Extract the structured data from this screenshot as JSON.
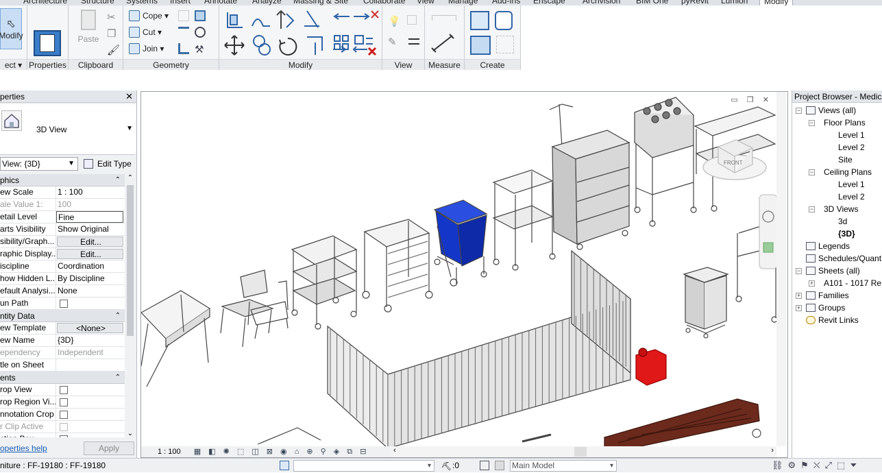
{
  "menu": {
    "tabs": [
      "Architecture",
      "Structure",
      "Systems",
      "Insert",
      "Annotate",
      "Analyze",
      "Massing & Site",
      "Collaborate",
      "View",
      "Manage",
      "Add-Ins",
      "Enscape",
      "Archvision",
      "BIM One",
      "pyRevit",
      "Lumion",
      "Modify"
    ],
    "active": "Modify"
  },
  "ribbon": {
    "select": {
      "modify_label": "Modify",
      "panel_label": "ect"
    },
    "properties": {
      "panel_label": "Properties"
    },
    "clipboard": {
      "paste_label": "Paste",
      "panel_label": "Clipboard"
    },
    "geometry": {
      "cope_label": "Cope",
      "cut_label": "Cut",
      "join_label": "Join",
      "panel_label": "Geometry"
    },
    "modify": {
      "panel_label": "Modify"
    },
    "view": {
      "panel_label": "View"
    },
    "measure": {
      "panel_label": "Measure"
    },
    "create": {
      "panel_label": "Create"
    }
  },
  "properties": {
    "title": "perties",
    "type_name": "3D View",
    "view_selector": "View: {3D}",
    "edit_type_label": "Edit Type",
    "sections": {
      "graphics": "phics",
      "identity": "ntity Data",
      "extents": "ents"
    },
    "rows": {
      "view_scale": {
        "key": "ew Scale",
        "value": "1 : 100"
      },
      "scale_value": {
        "key": "ale Value   1:",
        "value": "100"
      },
      "detail_level": {
        "key": "etail Level",
        "value": "Fine"
      },
      "parts_visibility": {
        "key": "arts Visibility",
        "value": "Show Original"
      },
      "vis_graph": {
        "key": "sibility/Graph...",
        "value": "Edit..."
      },
      "graphic_display": {
        "key": "raphic Display...",
        "value": "Edit..."
      },
      "discipline": {
        "key": "iscipline",
        "value": "Coordination"
      },
      "show_hidden": {
        "key": "how Hidden L...",
        "value": "By Discipline"
      },
      "default_analysis": {
        "key": "efault Analysi...",
        "value": "None"
      },
      "sun_path": {
        "key": "un Path"
      },
      "view_template": {
        "key": "ew Template",
        "value": "<None>"
      },
      "view_name": {
        "key": "ew Name",
        "value": "{3D}"
      },
      "dependency": {
        "key": "ependency",
        "value": "Independent"
      },
      "title_on_sheet": {
        "key": "tle on Sheet",
        "value": ""
      },
      "crop_view": {
        "key": "rop View"
      },
      "crop_region": {
        "key": "rop Region Vi..."
      },
      "annotation_crop": {
        "key": "nnotation Crop"
      },
      "far_clip": {
        "key": "r Clip Active"
      },
      "section_box": {
        "key": "ction Box"
      }
    },
    "help_link": "operties help",
    "apply_label": "Apply"
  },
  "viewport": {
    "scale": "1 : 100",
    "viewcube_label": "FRONT"
  },
  "browser": {
    "title": "Project Browser - Medical",
    "items": {
      "views_all": "Views (all)",
      "floor_plans": "Floor Plans",
      "fp_level1": "Level 1",
      "fp_level2": "Level 2",
      "site": "Site",
      "ceiling_plans": "Ceiling Plans",
      "cp_level1": "Level 1",
      "cp_level2": "Level 2",
      "views_3d": "3D Views",
      "v3d": "3d",
      "v3d_default": "{3D}",
      "legends": "Legends",
      "schedules": "Schedules/Quant",
      "sheets": "Sheets (all)",
      "sheet_a101": "A101 - 1017 Re",
      "families": "Families",
      "groups": "Groups",
      "revit_links": "Revit Links"
    }
  },
  "status": {
    "selection": "niture : FF-19180 : FF-19180",
    "count": ":0",
    "model": "Main Model"
  },
  "colors": {
    "accent": "#3a6ea5",
    "bin_blue": "#1436c8",
    "gascan_red": "#e01818",
    "bench_brown": "#6b2a1c"
  }
}
